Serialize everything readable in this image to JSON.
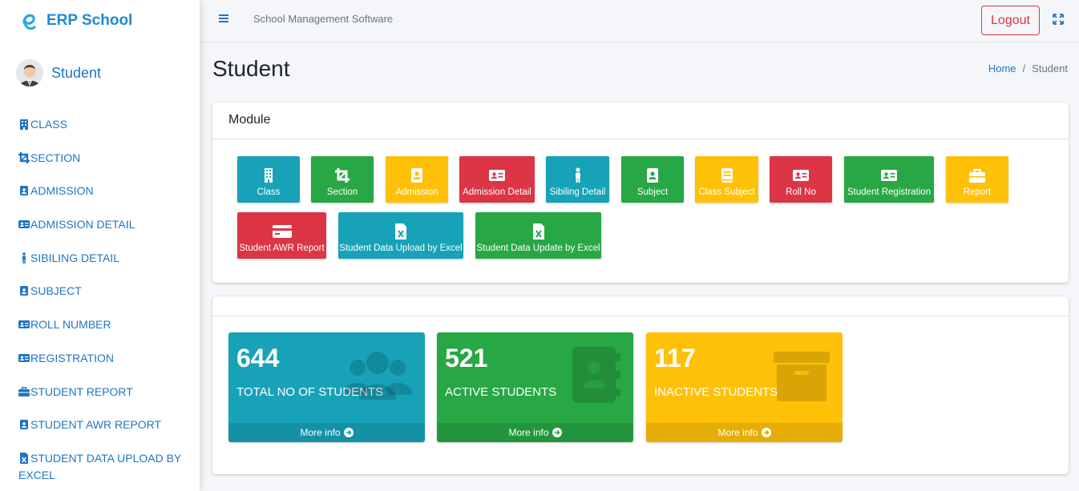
{
  "brand": {
    "name": "ERP School"
  },
  "user": {
    "name": "Student"
  },
  "sidebar": {
    "items": [
      {
        "label": "CLASS",
        "icon": "building-icon"
      },
      {
        "label": "SECTION",
        "icon": "crop-icon"
      },
      {
        "label": "ADMISSION",
        "icon": "id-badge-icon"
      },
      {
        "label": "ADMISSION DETAIL",
        "icon": "id-card-icon"
      },
      {
        "label": "SIBILING DETAIL",
        "icon": "person-icon"
      },
      {
        "label": "SUBJECT",
        "icon": "id-badge-icon"
      },
      {
        "label": "ROLL NUMBER",
        "icon": "id-card-icon"
      },
      {
        "label": "REGISTRATION",
        "icon": "id-card-icon"
      },
      {
        "label": "STUDENT REPORT",
        "icon": "briefcase-icon"
      },
      {
        "label": "STUDENT AWR REPORT",
        "icon": "id-badge-icon"
      },
      {
        "label": "STUDENT DATA UPLOAD BY EXCEL",
        "icon": "excel-file-icon"
      }
    ]
  },
  "topbar": {
    "title": "School Management Software",
    "logout_label": "Logout"
  },
  "page": {
    "title": "Student"
  },
  "breadcrumb": {
    "home": "Home",
    "separator": "/",
    "current": "Student"
  },
  "module": {
    "header": "Module",
    "tiles": [
      {
        "label": "Class",
        "color": "#17a2b8",
        "icon": "building-icon"
      },
      {
        "label": "Section",
        "color": "#28a745",
        "icon": "crop-icon"
      },
      {
        "label": "Admission",
        "color": "#ffc107",
        "icon": "id-badge-icon"
      },
      {
        "label": "Admission Detail",
        "color": "#dc3545",
        "icon": "id-card-icon"
      },
      {
        "label": "Sibiling Detail",
        "color": "#17a2b8",
        "icon": "person-icon"
      },
      {
        "label": "Subject",
        "color": "#28a745",
        "icon": "id-badge-icon"
      },
      {
        "label": "Class Subject",
        "color": "#ffc107",
        "icon": "book-icon"
      },
      {
        "label": "Roll No",
        "color": "#dc3545",
        "icon": "id-card-icon"
      },
      {
        "label": "Student Registration",
        "color": "#28a745",
        "icon": "id-card-icon"
      },
      {
        "label": "Report",
        "color": "#ffc107",
        "icon": "briefcase-icon"
      },
      {
        "label": "Student AWR Report",
        "color": "#dc3545",
        "icon": "credit-card-icon"
      },
      {
        "label": "Student Data Upload by Excel",
        "color": "#17a2b8",
        "icon": "excel-file-icon"
      },
      {
        "label": "Student Data Update by Excel",
        "color": "#28a745",
        "icon": "excel-file-icon"
      }
    ]
  },
  "stats": [
    {
      "number": "644",
      "label": "TOTAL NO OF STUDENTS",
      "more": "More info",
      "color": "#17a2b8",
      "icon": "users-icon"
    },
    {
      "number": "521",
      "label": "ACTIVE STUDENTS",
      "more": "More info",
      "color": "#28a745",
      "icon": "address-book-icon"
    },
    {
      "number": "117",
      "label": "INACTIVE STUDENTS",
      "more": "More info",
      "color": "#ffc107",
      "icon": "archive-icon"
    }
  ]
}
